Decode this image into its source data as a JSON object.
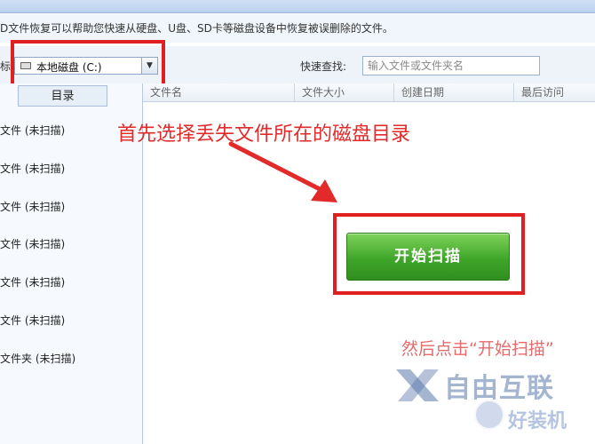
{
  "header": {
    "hint": "D文件恢复可以帮助您快速从硬盘、U盘、SD卡等磁盘设备中恢复被误删除的文件。"
  },
  "drive": {
    "prefix": "标:",
    "selected": "本地磁盘 (C:)",
    "arrow": "▼"
  },
  "search": {
    "label": "快速查找:",
    "placeholder": "输入文件或文件夹名"
  },
  "left_panel": {
    "tab_label": "目录",
    "items": [
      "文件 (未扫描)",
      "文件 (未扫描)",
      "文件 (未扫描)",
      "文件 (未扫描)",
      "文件 (未扫描)",
      "文件 (未扫描)",
      "文件夹 (未扫描)"
    ]
  },
  "columns": [
    "文件名",
    "文件大小",
    "创建日期",
    "最后访问"
  ],
  "annotations": {
    "step1": "首先选择丢失文件所在的磁盘目录",
    "step2": "然后点击“开始扫描”"
  },
  "scan_button": {
    "label": "开始扫描"
  },
  "watermark": {
    "brand": "自由互联",
    "sub": "好装机"
  },
  "colors": {
    "annotation_red": "#e32a2a",
    "button_green": "#3fa62a",
    "highlight_box": "#e02020"
  }
}
